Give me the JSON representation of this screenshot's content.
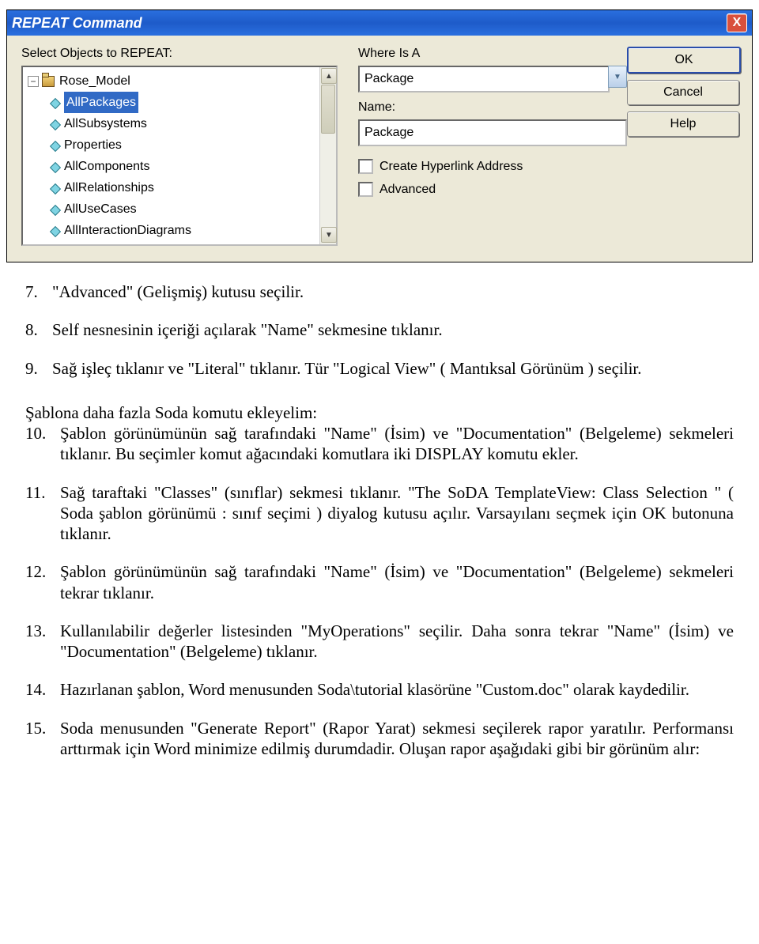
{
  "dialog": {
    "title": "REPEAT Command",
    "close_label": "X",
    "select_label": "Select Objects to REPEAT:",
    "where_label": "Where Is A",
    "where_value": "Package",
    "name_label": "Name:",
    "name_value": "Package",
    "hyperlink_label": "Create Hyperlink Address",
    "advanced_label": "Advanced",
    "buttons": {
      "ok": "OK",
      "cancel": "Cancel",
      "help": "Help"
    },
    "tree": {
      "root": "Rose_Model",
      "items": [
        "AllPackages",
        "AllSubsystems",
        "Properties",
        "AllComponents",
        "AllRelationships",
        "AllUseCases",
        "AllInteractionDiagrams"
      ],
      "selected": "AllPackages"
    }
  },
  "doc": {
    "p7_num": "7.",
    "p7": "\"Advanced\" (Gelişmiş) kutusu seçilir.",
    "p8_num": "8.",
    "p8": "Self nesnesinin içeriği açılarak \"Name\" sekmesine tıklanır.",
    "p9_num": "9.",
    "p9": "Sağ işleç tıklanır ve \"Literal\" tıklanır. Tür \"Logical View\" ( Mantıksal Görünüm ) seçilir.",
    "intro": "Şablona daha fazla Soda komutu ekleyelim:",
    "p10_num": "10.",
    "p10": "Şablon görünümünün sağ tarafındaki \"Name\" (İsim) ve \"Documentation\" (Belgeleme) sekmeleri tıklanır. Bu seçimler komut ağacındaki  komutlara iki DISPLAY komutu ekler.",
    "p11_num": "11.",
    "p11": "Sağ taraftaki \"Classes\" (sınıflar) sekmesi tıklanır. \"The SoDA TemplateView: Class Selection \" ( Soda şablon görünümü : sınıf seçimi )    diyalog kutusu açılır. Varsayılanı seçmek için OK butonuna tıklanır.",
    "p12_num": "12.",
    "p12": "Şablon görünümünün sağ tarafındaki \"Name\" (İsim) ve \"Documentation\" (Belgeleme) sekmeleri tekrar tıklanır.",
    "p13_num": "13.",
    "p13": "Kullanılabilir değerler listesinden \"MyOperations\" seçilir. Daha sonra tekrar \"Name\" (İsim) ve \"Documentation\" (Belgeleme) tıklanır.",
    "p14_num": "14.",
    "p14": "Hazırlanan şablon, Word menusunden Soda\\tutorial klasörüne \"Custom.doc\" olarak kaydedilir.",
    "p15_num": "15.",
    "p15": "Soda menusunden \"Generate Report\" (Rapor Yarat) sekmesi seçilerek rapor yaratılır. Performansı arttırmak için Word minimize edilmiş durumdadir. Oluşan rapor aşağıdaki gibi bir görünüm alır:"
  }
}
